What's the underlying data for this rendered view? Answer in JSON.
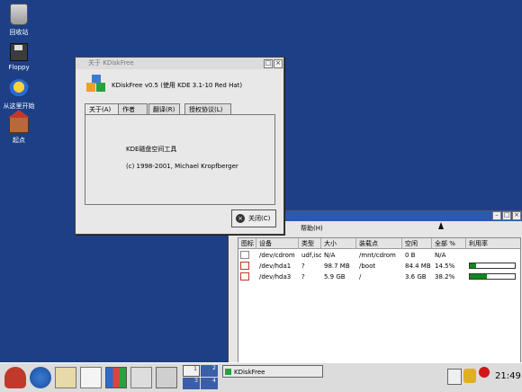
{
  "desktop": {
    "icons": [
      {
        "label": "回收站",
        "icon": "trash-icon"
      },
      {
        "label": "Floppy",
        "icon": "floppy-icon"
      },
      {
        "label": "从这里开始",
        "icon": "start-here-icon"
      },
      {
        "label": "起点",
        "icon": "home-icon"
      }
    ]
  },
  "about_window": {
    "title": "关于 KDiskFree",
    "app_title": "KDiskFree v0.5 (使用 KDE 3.1-10 Red Hat)",
    "tabs": [
      "关于(A)",
      "作者(U)",
      "翻译(R)",
      "授权协议(L)"
    ],
    "description": "KDE磁盘空间工具",
    "copyright": "(c) 1998-2001, Michael Kropfberger",
    "close_label": "关闭(C)"
  },
  "main_window": {
    "menu_help": "帮助(H)",
    "columns": [
      "图标",
      "设备",
      "类型",
      "大小",
      "装载点",
      "空闲",
      "全部 %",
      "利用率"
    ],
    "rows": [
      {
        "device": "/dev/cdrom",
        "type": "udf,iso...",
        "size": "N/A",
        "mount": "/mnt/cdrom",
        "free": "0 B",
        "full": "N/A",
        "usage": null
      },
      {
        "device": "/dev/hda1",
        "type": "?",
        "size": "98.7 MB",
        "mount": "/boot",
        "free": "84.4 MB",
        "full": "14.5%",
        "usage": 0.145
      },
      {
        "device": "/dev/hda3",
        "type": "?",
        "size": "5.9 GB",
        "mount": "/",
        "free": "3.6 GB",
        "full": "38.2%",
        "usage": 0.382
      }
    ]
  },
  "taskbar": {
    "pager": [
      "1",
      "2",
      "3",
      "4"
    ],
    "task_label": "KDiskFree",
    "clock": "21:49"
  },
  "colors": {
    "desktop": "#1d3f86",
    "usage_fill": "#0c8a1c",
    "device_icon_border": "#c0392b"
  }
}
